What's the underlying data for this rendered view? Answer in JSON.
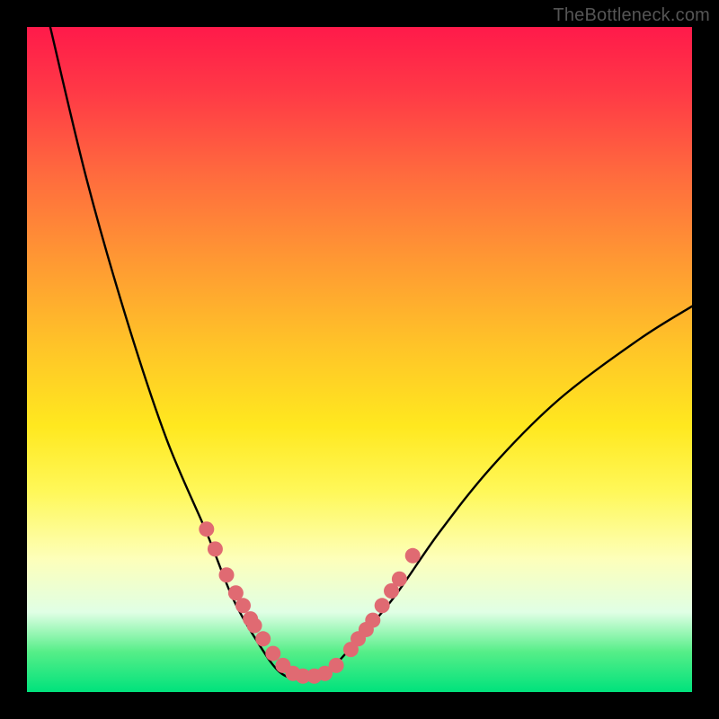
{
  "attribution_text": "TheBottleneck.com",
  "chart_data": {
    "type": "line",
    "title": "",
    "xlabel": "",
    "ylabel": "",
    "xlim": [
      0,
      1
    ],
    "ylim": [
      0,
      1
    ],
    "notes": "V-shaped bottleneck curve rendered over a vertical rainbow gradient (red at top → green at bottom). Axis scales are not shown in the image; x/y are normalized 0–1. y represents bottleneck severity (0 = ideal, 1 = worst); the curve minimum near x≈0.41 sits at y≈0.02. Pink dots cluster along both arms of the curve around the minimum.",
    "series": [
      {
        "name": "bottleneck-curve",
        "x": [
          0.035,
          0.09,
          0.15,
          0.21,
          0.27,
          0.31,
          0.35,
          0.38,
          0.41,
          0.45,
          0.49,
          0.55,
          0.62,
          0.7,
          0.8,
          0.92,
          1.0
        ],
        "y": [
          1.0,
          0.77,
          0.56,
          0.38,
          0.24,
          0.14,
          0.07,
          0.03,
          0.02,
          0.03,
          0.07,
          0.14,
          0.24,
          0.34,
          0.44,
          0.53,
          0.58
        ]
      }
    ],
    "points": {
      "name": "markers",
      "color": "#e06a72",
      "x": [
        0.27,
        0.283,
        0.3,
        0.314,
        0.325,
        0.336,
        0.342,
        0.355,
        0.37,
        0.385,
        0.4,
        0.415,
        0.432,
        0.448,
        0.465,
        0.487,
        0.498,
        0.51,
        0.52,
        0.534,
        0.548,
        0.56,
        0.58
      ],
      "y": [
        0.245,
        0.215,
        0.176,
        0.149,
        0.13,
        0.11,
        0.1,
        0.08,
        0.058,
        0.04,
        0.028,
        0.024,
        0.024,
        0.028,
        0.04,
        0.064,
        0.08,
        0.094,
        0.108,
        0.13,
        0.152,
        0.17,
        0.205
      ]
    },
    "gradient_stops": [
      {
        "pos": 0.0,
        "color": "#ff1a4a"
      },
      {
        "pos": 0.1,
        "color": "#ff3a46"
      },
      {
        "pos": 0.22,
        "color": "#ff6a3e"
      },
      {
        "pos": 0.35,
        "color": "#ff9833"
      },
      {
        "pos": 0.48,
        "color": "#ffc428"
      },
      {
        "pos": 0.6,
        "color": "#ffe81f"
      },
      {
        "pos": 0.7,
        "color": "#fff85a"
      },
      {
        "pos": 0.8,
        "color": "#fdffba"
      },
      {
        "pos": 0.88,
        "color": "#e0ffe5"
      },
      {
        "pos": 0.94,
        "color": "#55ee88"
      },
      {
        "pos": 1.0,
        "color": "#00e27c"
      }
    ]
  }
}
